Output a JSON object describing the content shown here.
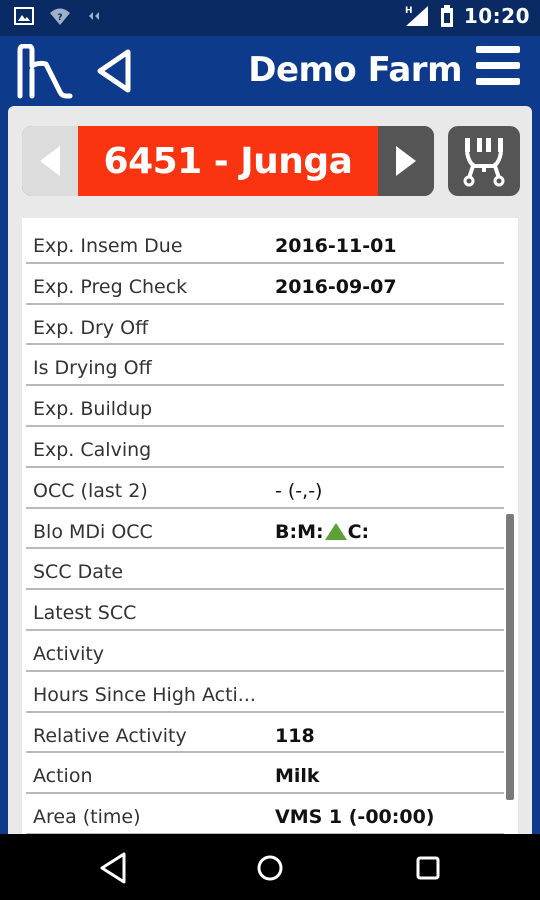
{
  "status_bar": {
    "time": "10:20",
    "icons": [
      "image-icon",
      "wifi-icon",
      "cast-icon",
      "signal-icon",
      "battery-icon"
    ]
  },
  "app_bar": {
    "farm_name": "Demo Farm"
  },
  "animal_selector": {
    "title": "6451 - Junga"
  },
  "details": {
    "rows": [
      {
        "label": "Exp. Insem Due",
        "value": "2016-11-01"
      },
      {
        "label": "Exp. Preg Check",
        "value": "2016-09-07"
      },
      {
        "label": "Exp. Dry Off",
        "value": ""
      },
      {
        "label": "Is Drying Off",
        "value": ""
      },
      {
        "label": "Exp. Buildup",
        "value": ""
      },
      {
        "label": "Exp. Calving",
        "value": ""
      },
      {
        "label": "OCC (last 2)",
        "value": "- (-,-)"
      },
      {
        "label": "Blo MDi OCC",
        "value_parts": [
          "B:M:",
          "C:"
        ]
      },
      {
        "label": "SCC Date",
        "value": ""
      },
      {
        "label": "Latest SCC",
        "value": ""
      },
      {
        "label": "Activity",
        "value": ""
      },
      {
        "label": "Hours Since High Acti...",
        "value": ""
      },
      {
        "label": "Relative Activity",
        "value": "118"
      },
      {
        "label": "Action",
        "value": "Milk"
      },
      {
        "label": "Area (time)",
        "value": "VMS 1 (-00:00)"
      }
    ]
  },
  "colors": {
    "header_blue": "#0d3a8a",
    "animal_title_red": "#fa3310",
    "status_green": "#5aa233"
  }
}
